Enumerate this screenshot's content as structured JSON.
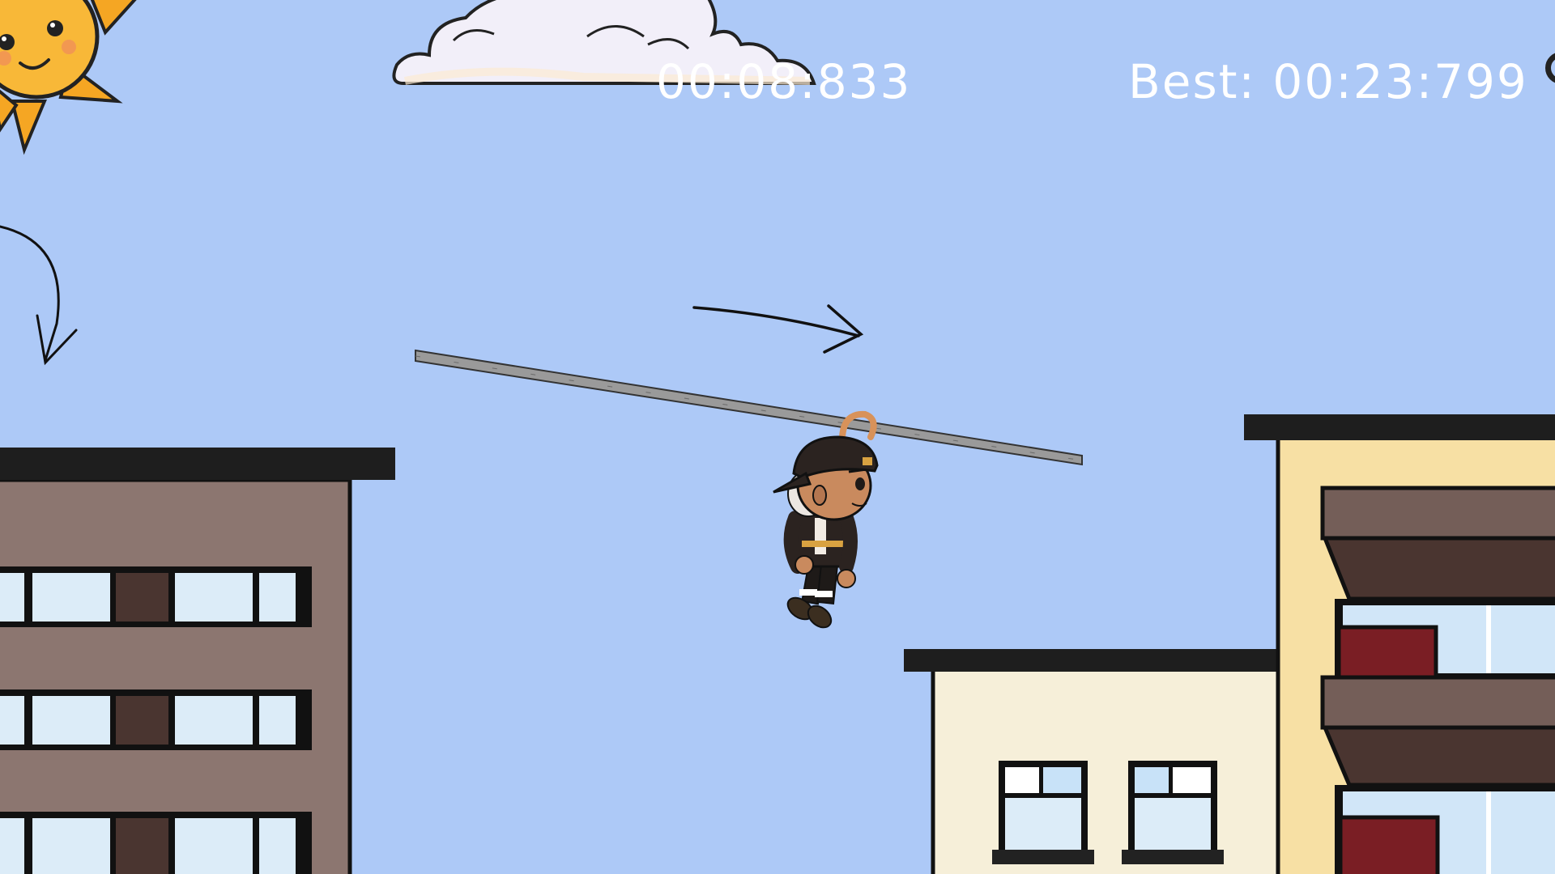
{
  "hud": {
    "timer": "00:08:833",
    "best_label": "Best:",
    "best_time": "00:23:799"
  },
  "icons": {
    "sun": "sun-icon",
    "cloud": "cloud-icon",
    "arrow_curved": "curved-down-arrow-icon",
    "arrow_right": "right-arrow-icon"
  },
  "colors": {
    "sky": "#adc9f7",
    "hud_text": "#ffffff",
    "building_brown": "#8c7670",
    "building_cream": "#f6efd9",
    "building_yellow": "#f7e0a4",
    "roof": "#1e1e1e",
    "window_glass": "#dcecf8",
    "window_dark": "#4a3530",
    "balcony_red": "#7a1e24"
  }
}
